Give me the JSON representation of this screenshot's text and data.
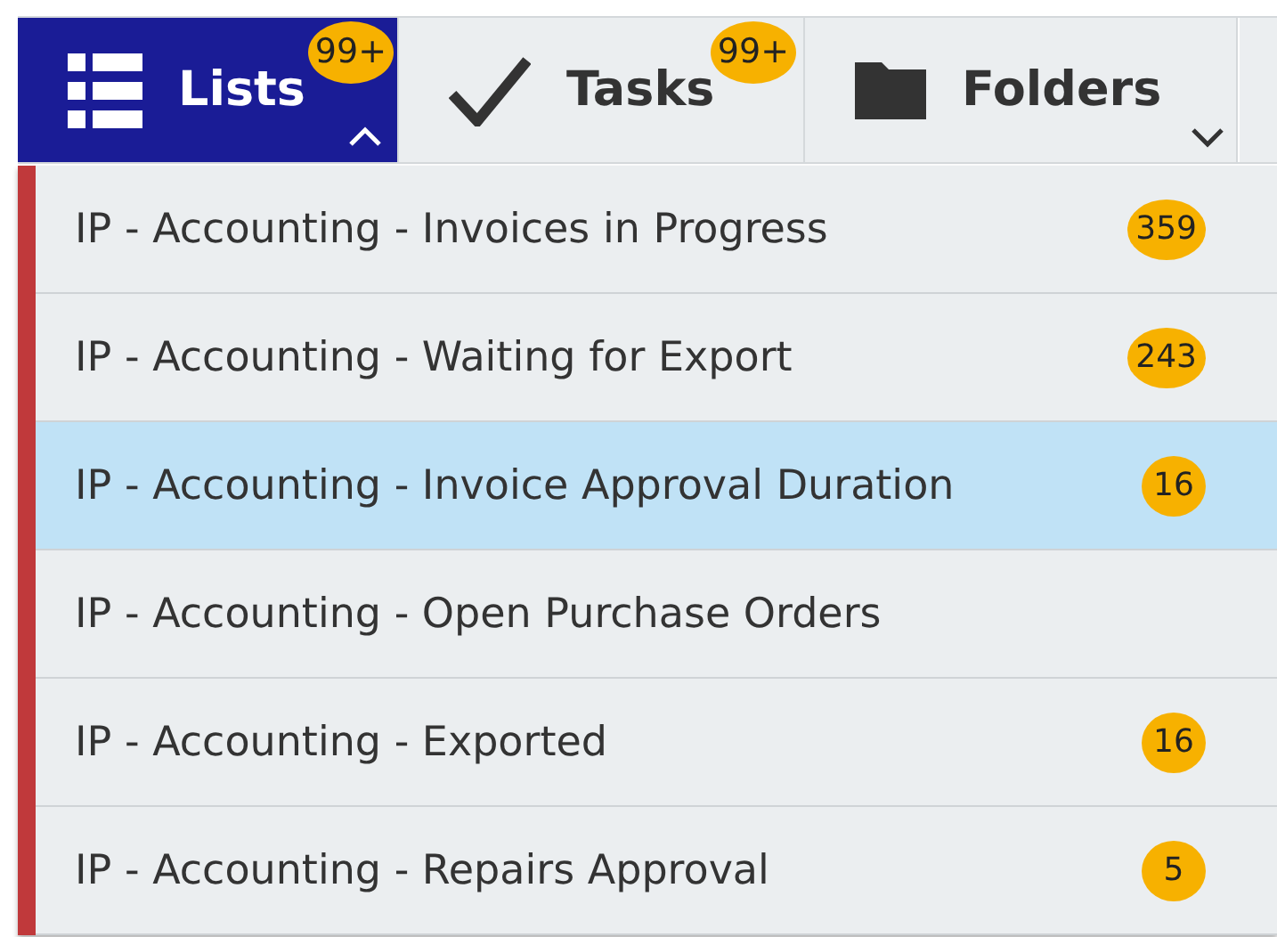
{
  "tabs": [
    {
      "label": "Lists",
      "selected": true,
      "badge": "99+",
      "expanded": true
    },
    {
      "label": "Tasks",
      "selected": false,
      "badge": "99+"
    },
    {
      "label": "Folders",
      "selected": false,
      "expanded": false
    }
  ],
  "menu": {
    "items": [
      {
        "label": "IP - Accounting - Invoices in Progress",
        "count": "359",
        "selected": false
      },
      {
        "label": "IP - Accounting - Waiting for Export",
        "count": "243",
        "selected": false
      },
      {
        "label": "IP - Accounting - Invoice Approval Duration",
        "count": "16",
        "selected": true
      },
      {
        "label": "IP - Accounting - Open Purchase Orders",
        "selected": false
      },
      {
        "label": "IP - Accounting - Exported",
        "count": "16",
        "selected": false
      },
      {
        "label": "IP - Accounting - Repairs Approval",
        "count": "5",
        "selected": false
      }
    ]
  }
}
